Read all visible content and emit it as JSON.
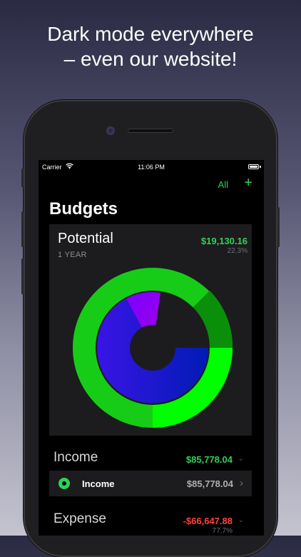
{
  "promo": {
    "line1": "Dark mode everywhere",
    "line2": "– even our website!"
  },
  "status_bar": {
    "carrier": "Carrier",
    "time": "11:06 PM"
  },
  "nav": {
    "filter_label": "All",
    "add_label": "+"
  },
  "page": {
    "title": "Budgets"
  },
  "budget_card": {
    "name": "Potential",
    "period": "1 YEAR",
    "amount": "$19,130.16",
    "percent": "22.3%"
  },
  "sections": {
    "income": {
      "label": "Income",
      "amount": "$85,778.04",
      "color": "#30d158"
    },
    "expense": {
      "label": "Expense",
      "amount": "-$66,647.88",
      "percent": "77.7%",
      "color": "#ff453a"
    }
  },
  "income_rows": [
    {
      "label": "Income",
      "amount": "$85,778.04",
      "icon": "green-dot-icon"
    }
  ],
  "colors": {
    "accent": "#30d158",
    "outer_ring": "#00e600",
    "inner_blue": "#0000c8",
    "inner_purple": "#8a00ff"
  }
}
